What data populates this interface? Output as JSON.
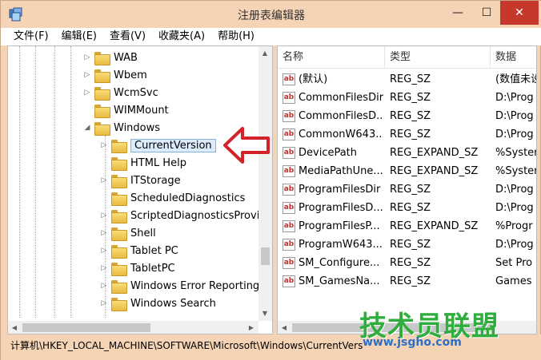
{
  "window": {
    "title": "注册表编辑器",
    "min_glyph": "—",
    "max_glyph": "☐",
    "close_glyph": "✕",
    "accent_close": "#c7382c"
  },
  "menu": [
    "文件(F)",
    "编辑(E)",
    "查看(V)",
    "收藏夹(A)",
    "帮助(H)"
  ],
  "tree": {
    "items": [
      {
        "label": "WAB",
        "arrow": "▷"
      },
      {
        "label": "Wbem",
        "arrow": "▷"
      },
      {
        "label": "WcmSvc",
        "arrow": "▷"
      },
      {
        "label": "WIMMount",
        "arrow": ""
      },
      {
        "label": "Windows",
        "arrow": "◢"
      },
      {
        "label": "CurrentVersion",
        "arrow": "▷"
      },
      {
        "label": "HTML Help",
        "arrow": ""
      },
      {
        "label": "ITStorage",
        "arrow": "▷"
      },
      {
        "label": "ScheduledDiagnostics",
        "arrow": ""
      },
      {
        "label": "ScriptedDiagnosticsProvi",
        "arrow": "▷"
      },
      {
        "label": "Shell",
        "arrow": "▷"
      },
      {
        "label": "Tablet PC",
        "arrow": "▷"
      },
      {
        "label": "TabletPC",
        "arrow": "▷"
      },
      {
        "label": "Windows Error Reporting",
        "arrow": "▷"
      },
      {
        "label": "Windows Search",
        "arrow": "▷"
      }
    ]
  },
  "list": {
    "headers": [
      "名称",
      "类型",
      "数据"
    ],
    "rows": [
      {
        "name": "(默认)",
        "type": "REG_SZ",
        "data": "(数值未设"
      },
      {
        "name": "CommonFilesDir",
        "type": "REG_SZ",
        "data": "D:\\Prog"
      },
      {
        "name": "CommonFilesD...",
        "type": "REG_SZ",
        "data": "D:\\Prog"
      },
      {
        "name": "CommonW643...",
        "type": "REG_SZ",
        "data": "D:\\Prog"
      },
      {
        "name": "DevicePath",
        "type": "REG_EXPAND_SZ",
        "data": "%Syster"
      },
      {
        "name": "MediaPathUne...",
        "type": "REG_EXPAND_SZ",
        "data": "%Syster"
      },
      {
        "name": "ProgramFilesDir",
        "type": "REG_SZ",
        "data": "D:\\Prog"
      },
      {
        "name": "ProgramFilesD...",
        "type": "REG_SZ",
        "data": "D:\\Prog"
      },
      {
        "name": "ProgramFilesP...",
        "type": "REG_EXPAND_SZ",
        "data": "%Progr"
      },
      {
        "name": "ProgramW643...",
        "type": "REG_SZ",
        "data": "D:\\Prog"
      },
      {
        "name": "SM_Configure...",
        "type": "REG_SZ",
        "data": "Set Pro"
      },
      {
        "name": "SM_GamesNa...",
        "type": "REG_SZ",
        "data": "Games"
      }
    ],
    "icon_text": "ab"
  },
  "status": {
    "path": "计算机\\HKEY_LOCAL_MACHINE\\SOFTWARE\\Microsoft\\Windows\\CurrentVersion"
  },
  "watermark": {
    "title": "技术员联盟",
    "url": "www.jsgho.com"
  }
}
